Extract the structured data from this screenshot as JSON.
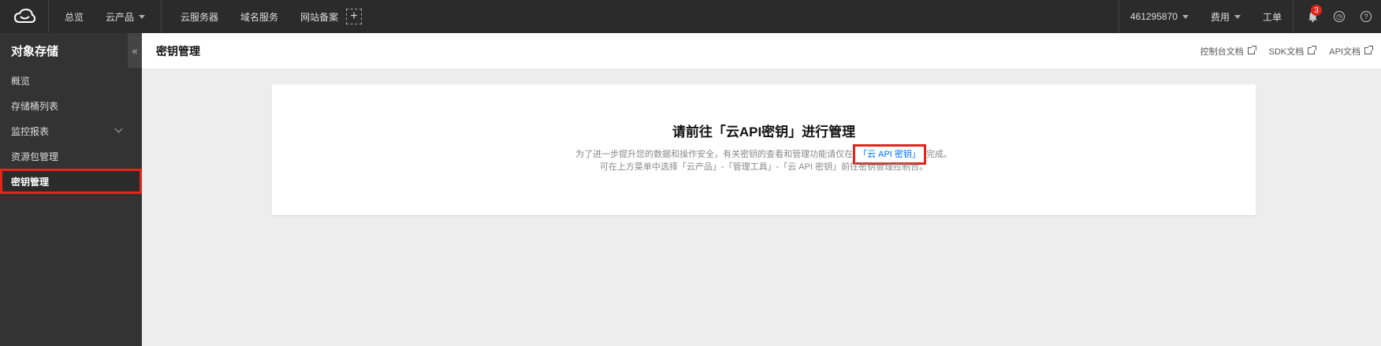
{
  "topbar": {
    "nav": [
      "总览",
      "云产品"
    ],
    "nav2": [
      "云服务器",
      "域名服务",
      "网站备案"
    ],
    "plus": "+",
    "account": "461295870",
    "billing": "费用",
    "ticket": "工单",
    "notif_count": "3"
  },
  "sidebar": {
    "title": "对象存储",
    "collapse": "«",
    "items": [
      {
        "label": "概览"
      },
      {
        "label": "存储桶列表"
      },
      {
        "label": "监控报表"
      },
      {
        "label": "资源包管理"
      },
      {
        "label": "密钥管理"
      }
    ]
  },
  "main": {
    "title": "密钥管理",
    "docs": [
      "控制台文档",
      "SDK文档",
      "API文档"
    ]
  },
  "card": {
    "title": "请前往「云API密钥」进行管理",
    "line1_before": "为了进一步提升您的数据和操作安全，有关密钥的查看和管理功能请仅在",
    "line1_link": "「云 API 密钥」",
    "line1_after": "完成。",
    "line2": "可在上方菜单中选择「云产品」-「管理工具」-「云 API 密钥」前往密钥管理控制台。"
  }
}
